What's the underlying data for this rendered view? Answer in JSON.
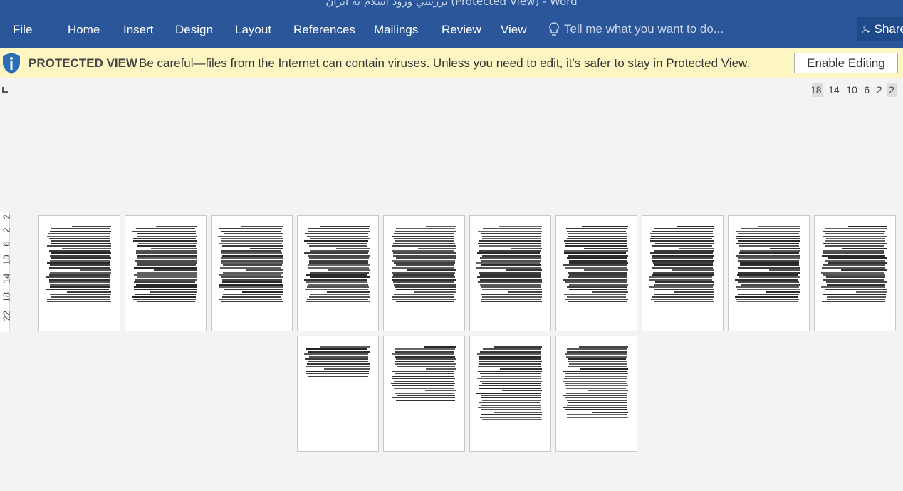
{
  "window": {
    "title": "بررسي ورود اسلام به ايران (Protected View) - Word"
  },
  "ribbon": {
    "tabs": [
      "File",
      "Home",
      "Insert",
      "Design",
      "Layout",
      "References",
      "Mailings",
      "Review",
      "View"
    ],
    "tell_me": "Tell me what you want to do...",
    "share": "Share"
  },
  "protected_view": {
    "label": "PROTECTED VIEW",
    "message": "Be careful—files from the Internet can contain viruses. Unless you need to edit, it's safer to stay in Protected View.",
    "button": "Enable Editing"
  },
  "horizontal_ruler": [
    "18",
    "14",
    "10",
    "6",
    "2",
    "2"
  ],
  "vertical_ruler": [
    "22",
    "18",
    "14",
    "10",
    "6",
    "2",
    "2"
  ],
  "colors": {
    "ribbon": "#2b579a",
    "banner": "#fdf6c3"
  }
}
